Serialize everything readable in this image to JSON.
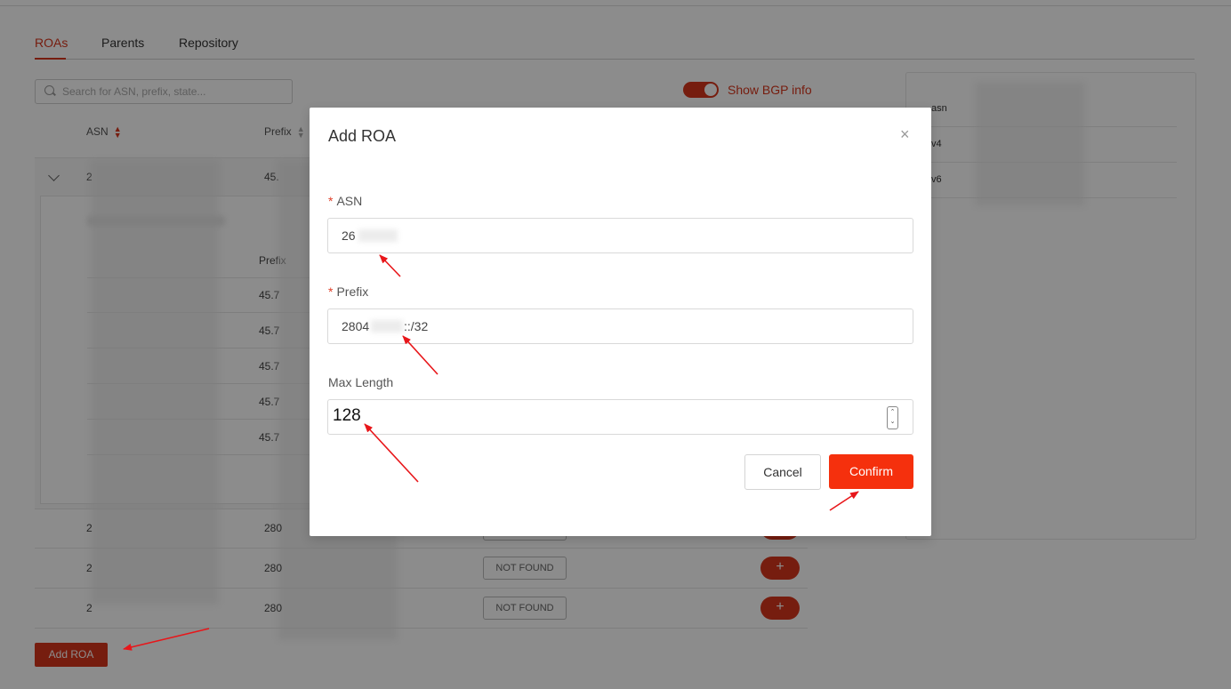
{
  "tabs": [
    {
      "label": "ROAs",
      "active": true
    },
    {
      "label": "Parents",
      "active": false
    },
    {
      "label": "Repository",
      "active": false
    }
  ],
  "search": {
    "placeholder": "Search for ASN, prefix, state..."
  },
  "bgp_toggle": {
    "label": "Show BGP info",
    "on": true
  },
  "table": {
    "headers": {
      "asn": "ASN",
      "prefix": "Prefix"
    },
    "expanded_row": {
      "asn_prefix": "2",
      "prefix_prefix": "45."
    },
    "inner": {
      "header_prefix": "Prefix",
      "rows": [
        "45.7",
        "45.7",
        "45.7",
        "45.7",
        "45.7"
      ]
    },
    "rows": [
      {
        "asn": "2",
        "prefix": "280",
        "state": "NOT FOUND"
      },
      {
        "asn": "2",
        "prefix": "280",
        "state": "NOT FOUND"
      },
      {
        "asn": "2",
        "prefix": "280",
        "state": "NOT FOUND"
      }
    ],
    "plus_label": "+"
  },
  "add_roa_button": "Add ROA",
  "side_panel": {
    "rows": [
      {
        "label": "asn"
      },
      {
        "label": "v4"
      },
      {
        "label": "v6"
      }
    ]
  },
  "modal": {
    "title": "Add ROA",
    "close_label": "×",
    "asn": {
      "label": "ASN",
      "required": true,
      "value": "26"
    },
    "prefix": {
      "label": "Prefix",
      "required": true,
      "value_start": "2804",
      "value_end": "::/32"
    },
    "max_length": {
      "label": "Max Length",
      "value": "128"
    },
    "cancel_label": "Cancel",
    "confirm_label": "Confirm"
  },
  "colors": {
    "accent": "#d8361c",
    "confirm": "#f5300d",
    "arrow": "#e8161a"
  }
}
